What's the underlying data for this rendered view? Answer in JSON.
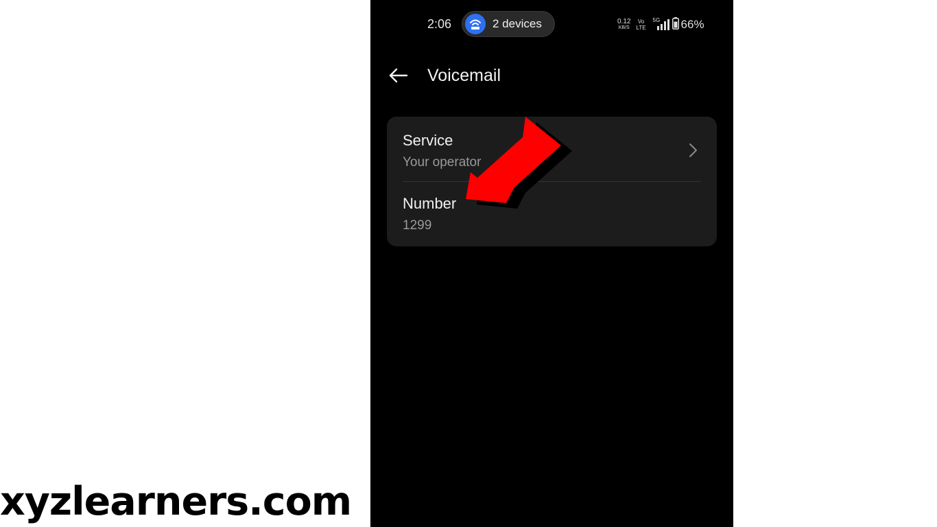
{
  "status_bar": {
    "time": "2:06",
    "hotspot_label": "2 devices",
    "net_speed_value": "0.12",
    "net_speed_unit": "KB/S",
    "volte_top": "Vo",
    "volte_bottom": "LTE",
    "network_type": "5G",
    "battery_percent": "66%",
    "icons": [
      "hotspot-icon",
      "signal-icon",
      "battery-icon"
    ]
  },
  "header": {
    "title": "Voicemail",
    "back_icon": "arrow-left-icon"
  },
  "settings": {
    "items": [
      {
        "title": "Service",
        "subtitle": "Your operator",
        "trailing_icon": "chevron-right-icon"
      },
      {
        "title": "Number",
        "subtitle": "1299"
      }
    ]
  },
  "annotation": {
    "arrow_icon": "red-pointer-arrow-icon",
    "arrow_color": "#ff0000"
  },
  "watermark": {
    "text": "xyzlearners.com"
  },
  "colors": {
    "phone_background": "#000000",
    "card_background": "#1c1c1c",
    "hotspot_accent": "#2f6ff2",
    "page_background": "#ffffff"
  }
}
